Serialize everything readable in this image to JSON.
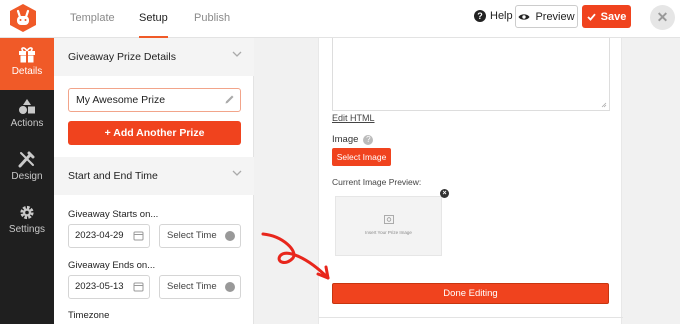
{
  "header": {
    "tabs": [
      "Template",
      "Setup",
      "Publish"
    ],
    "active_tab": "Setup",
    "help_label": "Help",
    "preview_label": "Preview",
    "save_label": "Save"
  },
  "sidebar": {
    "items": [
      {
        "label": "Details",
        "icon": "gift-icon",
        "active": true
      },
      {
        "label": "Actions",
        "icon": "shapes-icon",
        "active": false
      },
      {
        "label": "Design",
        "icon": "design-tools-icon",
        "active": false
      },
      {
        "label": "Settings",
        "icon": "gear-icon",
        "active": false
      }
    ]
  },
  "panel": {
    "prize_section_title": "Giveaway Prize Details",
    "prize_value": "My Awesome Prize",
    "add_prize_label": "Add Another Prize",
    "time_section_title": "Start and End Time",
    "starts_label": "Giveaway Starts on...",
    "start_date": "2023-04-29",
    "start_time_placeholder": "Select Time",
    "ends_label": "Giveaway Ends on...",
    "end_date": "2023-05-13",
    "end_time_placeholder": "Select Time",
    "timezone_label": "Timezone"
  },
  "editor": {
    "edit_html_label": "Edit HTML",
    "image_label": "Image",
    "select_image_label": "Select Image",
    "current_image_label": "Current Image Preview:",
    "image_caption": "Insert Your Prize Image",
    "done_label": "Done Editing"
  },
  "colors": {
    "accent": "#f0431e",
    "sidebar_bg": "#1f1f1f",
    "annotation_arrow": "#e8261c"
  }
}
